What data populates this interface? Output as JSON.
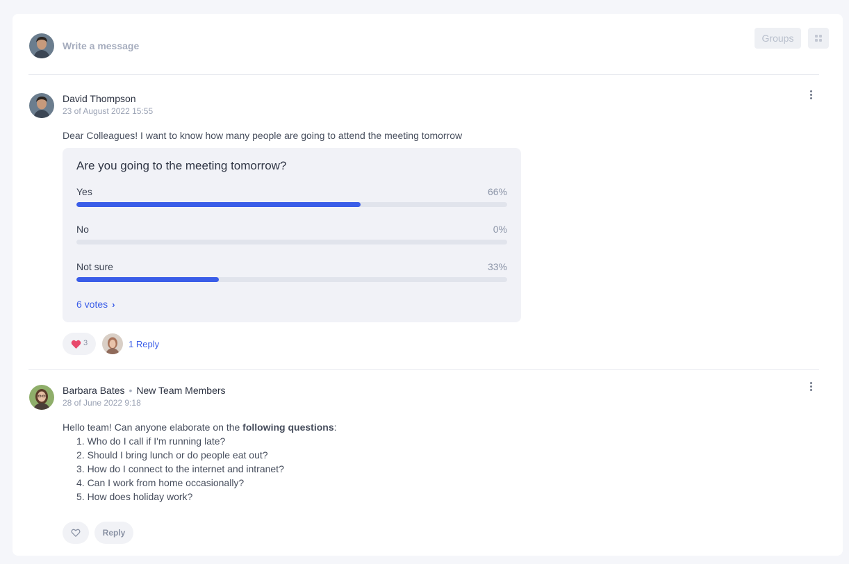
{
  "composer": {
    "placeholder": "Write a message",
    "groups_label": "Groups"
  },
  "posts": [
    {
      "author": "David Thompson",
      "date": "23 of August 2022 15:55",
      "text": "Dear Colleagues! I want to know how many people are going to attend the meeting tomorrow",
      "poll": {
        "question": "Are you going to the meeting tomorrow?",
        "options": [
          {
            "label": "Yes",
            "percent_text": "66%",
            "percent": 66
          },
          {
            "label": "No",
            "percent_text": "0%",
            "percent": 0
          },
          {
            "label": "Not sure",
            "percent_text": "33%",
            "percent": 33
          }
        ],
        "votes": "6 votes"
      },
      "likes": "3",
      "replies": "1 Reply"
    },
    {
      "author": "Barbara Bates",
      "group": "New Team Members",
      "date": "28 of June 2022 9:18",
      "intro": "Hello team! Can anyone elaborate on the ",
      "intro_bold": "following questions",
      "intro_end": ":",
      "questions": [
        "1. Who do I call if I'm running late?",
        "2. Should I bring lunch or do people eat out?",
        "3. How do I connect to the internet and intranet?",
        "4. Can I work from home occasionally?",
        "5. How does holiday work?"
      ],
      "reply_label": "Reply"
    }
  ],
  "colors": {
    "accent": "#3a5de8",
    "heart": "#e8496b"
  }
}
